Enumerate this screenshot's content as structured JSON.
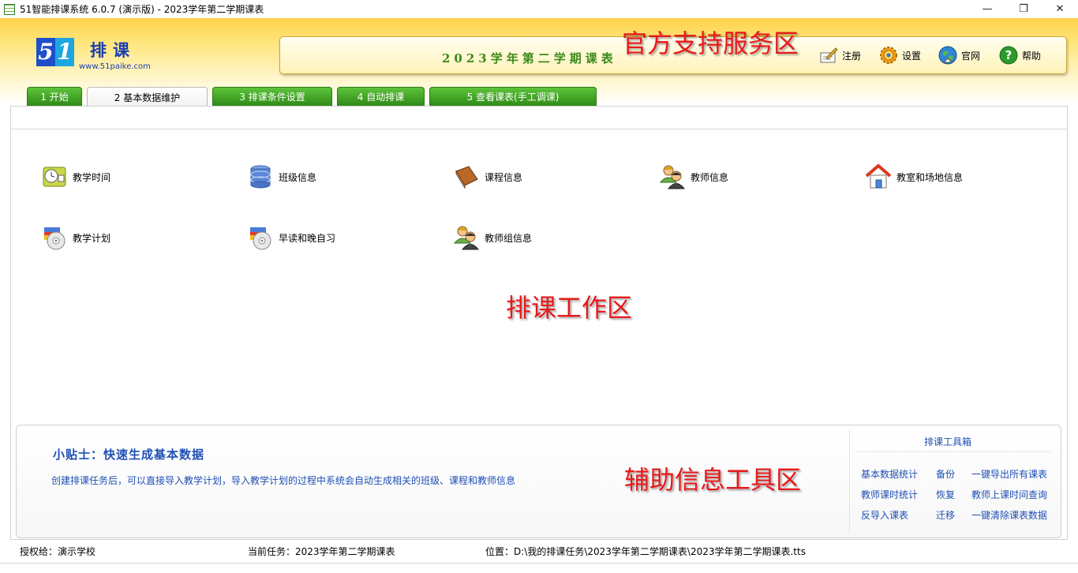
{
  "window": {
    "title": "51智能排课系统 6.0.7 (演示版) - 2023学年第二学期课表",
    "minimize": "—",
    "restore": "❐",
    "close": "✕"
  },
  "logo": {
    "digit_5": "5",
    "digit_1": "1",
    "name": "排课",
    "url": "www.51paike.com"
  },
  "header": {
    "semester": "2023学年第二学期课表",
    "service_buttons": [
      {
        "label": "注册",
        "icon": "register-pen-icon"
      },
      {
        "label": "设置",
        "icon": "settings-gear-icon"
      },
      {
        "label": "官网",
        "icon": "website-globe-icon"
      },
      {
        "label": "帮助",
        "icon": "help-question-icon"
      }
    ]
  },
  "annotations": {
    "service_area": "官方支持服务区",
    "work_area": "排课工作区",
    "aux_area": "辅助信息工具区"
  },
  "tabs": [
    {
      "label": "1 开始",
      "active": false
    },
    {
      "label": "2 基本数据维护",
      "active": true
    },
    {
      "label": "3 排课条件设置",
      "active": false
    },
    {
      "label": "4 自动排课",
      "active": false
    },
    {
      "label": "5 查看课表(手工调课)",
      "active": false
    }
  ],
  "workspace": {
    "items": [
      {
        "label": "教学时间",
        "icon": "teaching-time-clock-icon"
      },
      {
        "label": "班级信息",
        "icon": "class-database-icon"
      },
      {
        "label": "课程信息",
        "icon": "course-book-icon"
      },
      {
        "label": "教师信息",
        "icon": "teacher-users-icon"
      },
      {
        "label": "教室和场地信息",
        "icon": "classroom-house-icon"
      },
      {
        "label": "教学计划",
        "icon": "teaching-plan-disc-icon"
      },
      {
        "label": "早读和晚自习",
        "icon": "study-session-disc-icon"
      },
      {
        "label": "教师组信息",
        "icon": "teacher-group-icon"
      }
    ]
  },
  "tips": {
    "title": "小贴士：快速生成基本数据",
    "body": "创建排课任务后，可以直接导入教学计划，导入教学计划的过程中系统会自动生成相关的班级、课程和教师信息"
  },
  "toolbox": {
    "title": "排课工具箱",
    "tools": [
      "基本数据统计",
      "备份",
      "一键导出所有课表",
      "教师课时统计",
      "恢复",
      "教师上课时间查询",
      "反导入课表",
      "迁移",
      "一键清除课表数据"
    ]
  },
  "status": {
    "licensed_to": "授权给：演示学校",
    "current_task": "当前任务：2023学年第二学期课表",
    "location": "位置：D:\\我的排课任务\\2023学年第二学期课表\\2023学年第二学期课表.tts"
  },
  "colors": {
    "header_gold": "#ffd24a",
    "tab_green": "#2f8a17",
    "annotation_red": "#e8191a",
    "link_blue": "#1f4fb5"
  }
}
